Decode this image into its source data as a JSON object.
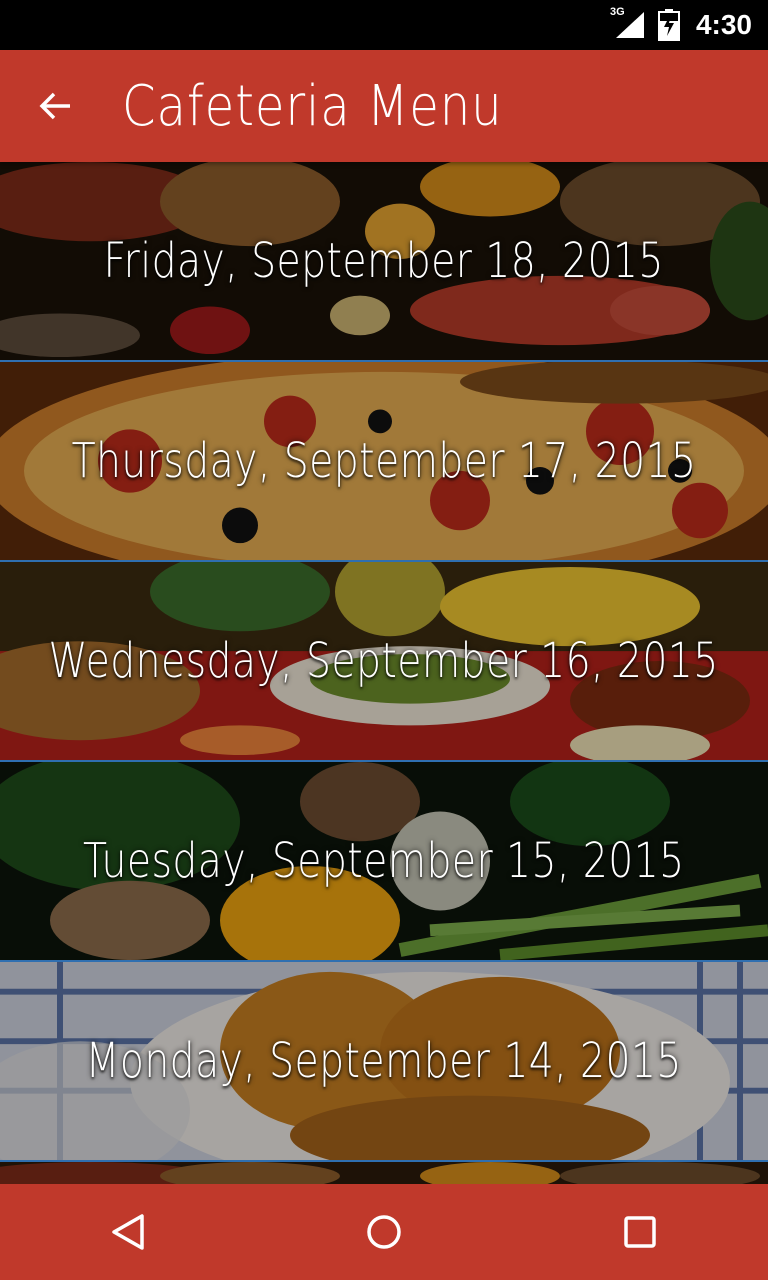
{
  "status_bar": {
    "network_label": "3G",
    "time": "4:30",
    "icons": [
      "signal-icon",
      "battery-charging-icon"
    ]
  },
  "app_bar": {
    "title": "Cafeteria Menu",
    "back_icon": "arrow-back-icon",
    "background_color": "#C0392B"
  },
  "menu": {
    "items": [
      {
        "date": "Friday, September 18, 2015",
        "image": "seafood-spread-image"
      },
      {
        "date": "Thursday, September 17, 2015",
        "image": "pizza-image"
      },
      {
        "date": "Wednesday, September 16, 2015",
        "image": "vegetables-bread-image"
      },
      {
        "date": "Tuesday, September 15, 2015",
        "image": "asparagus-peppers-image"
      },
      {
        "date": "Monday, September 14, 2015",
        "image": "croissants-image"
      }
    ]
  },
  "nav_bar": {
    "buttons": [
      "back-triangle-icon",
      "home-circle-icon",
      "recents-square-icon"
    ],
    "background_color": "#C0392B"
  }
}
